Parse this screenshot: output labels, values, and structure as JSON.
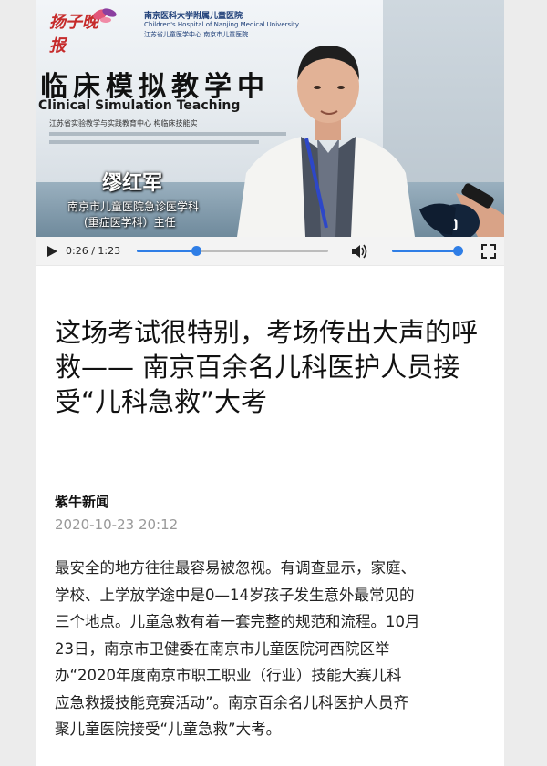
{
  "video": {
    "logo_text": "扬子晚报",
    "hospital_name_cn": "南京医科大学附属儿童医院",
    "hospital_name_en": "Children's Hospital of Nanjing Medical University",
    "hospital_sub": "江苏省儿童医学中心 南京市儿童医院",
    "sign_cn": "临床模拟教学中",
    "sign_en": "Clinical Simulation Teaching",
    "sign_sub": "江苏省实验教学与实践教育中心 构临床技能实",
    "caption_name": "缪红军",
    "caption_title_1": "南京市儿童医院急诊医学科",
    "caption_title_2": "(重症医学科）主任"
  },
  "player": {
    "time_display": "0:26 / 1:23",
    "progress": 0.31,
    "volume": 1.0,
    "play_icon": "play-icon",
    "volume_icon": "volume-icon",
    "fullscreen_icon": "fullscreen-icon"
  },
  "article": {
    "title": "这场考试很特别，考场传出大声的呼救—— 南京百余名儿科医护人员接受“儿科急救”大考",
    "source": "紫牛新闻",
    "date": "2020-10-23 20:12",
    "body_lines": [
      "最安全的地方往往最容易被忽视。有调查显示，家庭、",
      "学校、上学放学途中是0—14岁孩子发生意外最常见的",
      "三个地点。儿童急救有着一套完整的规范和流程。10月",
      "23日，南京市卫健委在南京市儿童医院河西院区举",
      "办“2020年度南京市职工职业（行业）技能大赛儿科",
      "应急救援技能竞赛活动”。南京百余名儿科医护人员齐",
      "聚儿童医院接受“儿童急救”大考。"
    ]
  },
  "colors": {
    "accent": "#2f7ee6",
    "logo_red": "#c62b2b",
    "date_gray": "#999999"
  }
}
